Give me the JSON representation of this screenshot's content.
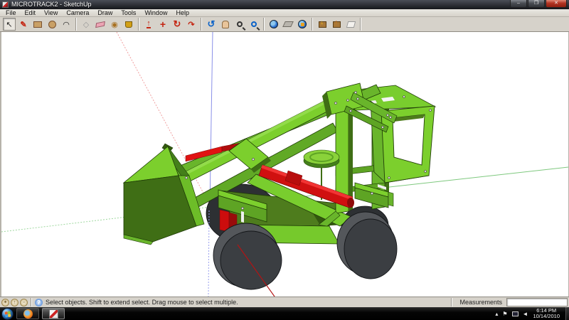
{
  "window": {
    "title": "MICROTRACK2 - SketchUp",
    "controls": {
      "minimize": "–",
      "maximize": "❐",
      "close": "✕"
    }
  },
  "menu": {
    "items": [
      "File",
      "Edit",
      "View",
      "Camera",
      "Draw",
      "Tools",
      "Window",
      "Help"
    ]
  },
  "toolbar": {
    "tools": [
      "Select",
      "Line",
      "Rectangle",
      "Circle",
      "Arc",
      "Make Component",
      "Eraser",
      "Tape Measure",
      "Paint Bucket",
      "Push/Pull",
      "Move",
      "Rotate",
      "Offset",
      "Orbit",
      "Pan",
      "Zoom",
      "Zoom Extents",
      "Get Current View",
      "Toggle Terrain",
      "Place Model",
      "Get Models",
      "Share Models",
      "Share Component"
    ]
  },
  "statusbar": {
    "message": "Select objects. Shift to extend select. Drag mouse to select multiple.",
    "measurements_label": "Measurements",
    "measurements_value": ""
  },
  "taskbar": {
    "apps": [
      "Firefox",
      "Google SketchUp"
    ],
    "tray_time": "6:14 PM",
    "tray_date": "10/14/2010"
  },
  "model": {
    "description": "green front-loader 3D model",
    "colors": {
      "green_bright": "#7ccf2d",
      "green_medium": "#69b52b",
      "green_olive": "#4e7c1d",
      "green_dark": "#3f6e15",
      "red_bright": "#d01010",
      "red_dark": "#990b0b",
      "wheel_face": "#3b3e42",
      "wheel_side": "#54575b",
      "axis_red": "#f0a0a0",
      "axis_green": "#7ec87e",
      "axis_blue": "#8a90e8"
    }
  }
}
